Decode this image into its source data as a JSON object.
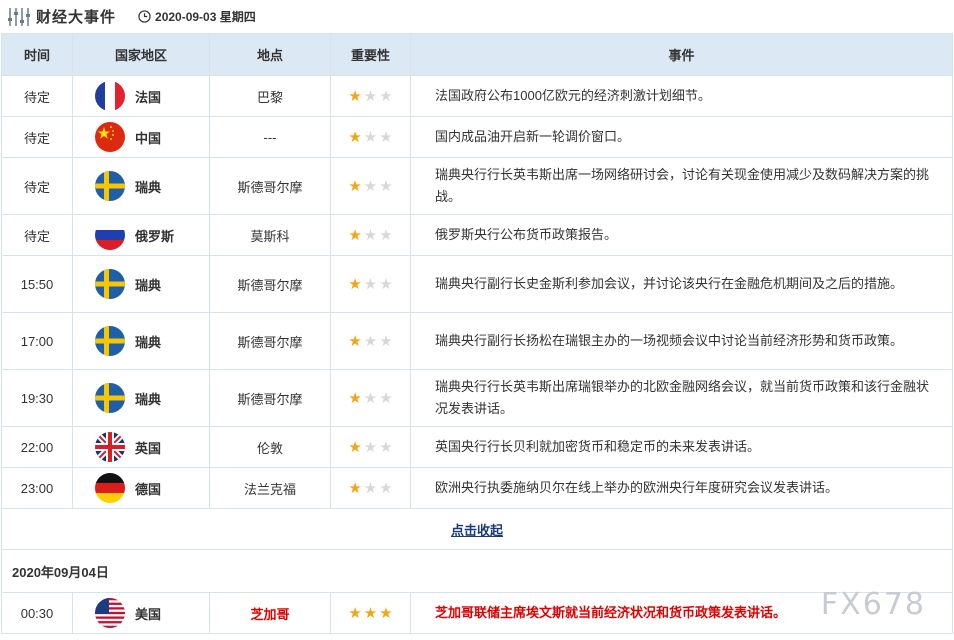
{
  "header": {
    "title": "财经大事件",
    "date": "2020-09-03 星期四"
  },
  "columns": [
    "时间",
    "国家地区",
    "地点",
    "重要性",
    "事件"
  ],
  "rows": [
    {
      "time": "待定",
      "country": "法国",
      "flag": "fr",
      "place": "巴黎",
      "stars": 1,
      "event": "法国政府公布1000亿欧元的经济刺激计划细节。"
    },
    {
      "time": "待定",
      "country": "中国",
      "flag": "cn",
      "place": "---",
      "stars": 1,
      "event": "国内成品油开启新一轮调价窗口。"
    },
    {
      "time": "待定",
      "country": "瑞典",
      "flag": "se",
      "place": "斯德哥尔摩",
      "stars": 1,
      "event": "瑞典央行行长英韦斯出席一场网络研讨会，讨论有关现金使用减少及数码解决方案的挑战。"
    },
    {
      "time": "待定",
      "country": "俄罗斯",
      "flag": "ru",
      "place": "莫斯科",
      "stars": 1,
      "event": "俄罗斯央行公布货币政策报告。"
    },
    {
      "time": "15:50",
      "country": "瑞典",
      "flag": "se",
      "place": "斯德哥尔摩",
      "stars": 1,
      "event": "瑞典央行副行长史金斯利参加会议，并讨论该央行在金融危机期间及之后的措施。"
    },
    {
      "time": "17:00",
      "country": "瑞典",
      "flag": "se",
      "place": "斯德哥尔摩",
      "stars": 1,
      "event": "瑞典央行副行长扬松在瑞银主办的一场视频会议中讨论当前经济形势和货币政策。"
    },
    {
      "time": "19:30",
      "country": "瑞典",
      "flag": "se",
      "place": "斯德哥尔摩",
      "stars": 1,
      "event": "瑞典央行行长英韦斯出席瑞银举办的北欧金融网络会议，就当前货币政策和该行金融状况发表讲话。"
    },
    {
      "time": "22:00",
      "country": "英国",
      "flag": "gb",
      "place": "伦敦",
      "stars": 1,
      "event": "英国央行行长贝利就加密货币和稳定币的未来发表讲话。"
    },
    {
      "time": "23:00",
      "country": "德国",
      "flag": "de",
      "place": "法兰克福",
      "stars": 1,
      "event": "欧洲央行执委施纳贝尔在线上举办的欧洲央行年度研究会议发表讲话。"
    }
  ],
  "collapse_label": "点击收起",
  "next_date": "2020年09月04日",
  "next_rows": [
    {
      "time": "00:30",
      "country": "美国",
      "flag": "us",
      "place": "芝加哥",
      "stars": 3,
      "event": "芝加哥联储主席埃文斯就当前经济状况和货币政策发表讲话。",
      "highlight": true
    }
  ],
  "watermark": "FX678",
  "colors": {
    "star_on": "#f3a612",
    "star_off": "#d8d8d8",
    "header_bg": "#dde8f5",
    "border": "#d6e3ef",
    "highlight": "#e00000"
  },
  "icons": {
    "logo": "sliders-icon",
    "clock": "clock-icon",
    "star": "star-icon"
  }
}
